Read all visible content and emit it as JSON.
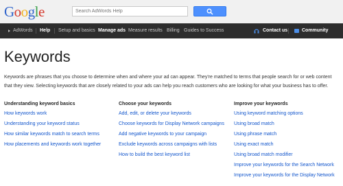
{
  "logo": {
    "letters": [
      "G",
      "o",
      "o",
      "g",
      "l",
      "e"
    ]
  },
  "search": {
    "placeholder": "Search AdWords Help",
    "button_icon": "search-icon"
  },
  "nav": {
    "items": [
      "AdWords",
      "Help",
      "Setup and basics",
      "Manage ads",
      "Measure results",
      "Billing",
      "Guides to Success"
    ],
    "contact": "Contact us",
    "community": "Community"
  },
  "page": {
    "title": "Keywords",
    "intro": "Keywords are phrases that you choose to determine when and where your ad can appear. They're matched to terms that people search for or web content that they view. Selecting keywords that are closely related to your ads can help you reach customers who are looking for what your business has to offer."
  },
  "columns": [
    {
      "heading": "Understanding keyword basics",
      "links": [
        "How keywords work",
        "Understanding your keyword status",
        "How similar keywords match to search terms",
        "How placements and keywords work together"
      ]
    },
    {
      "heading": "Choose your keywords",
      "links": [
        "Add, edit, or delete your keywords",
        "Choose keywords for Display Network campaigns",
        "Add negative keywords to your campaign",
        "Exclude keywords across campaigns with lists",
        "How to build the best keyword list"
      ]
    },
    {
      "heading": "Improve your keywords",
      "links": [
        "Using keyword matching options",
        "Using broad match",
        "Using phrase match",
        "Using exact match",
        "Using broad match modifier",
        "Improve your keywords for the Search Network",
        "Improve your keywords for the Display Network"
      ]
    }
  ],
  "colors": {
    "link": "#1155cc",
    "navbar": "#2d2d2d",
    "search_button": "#4d90fe"
  }
}
